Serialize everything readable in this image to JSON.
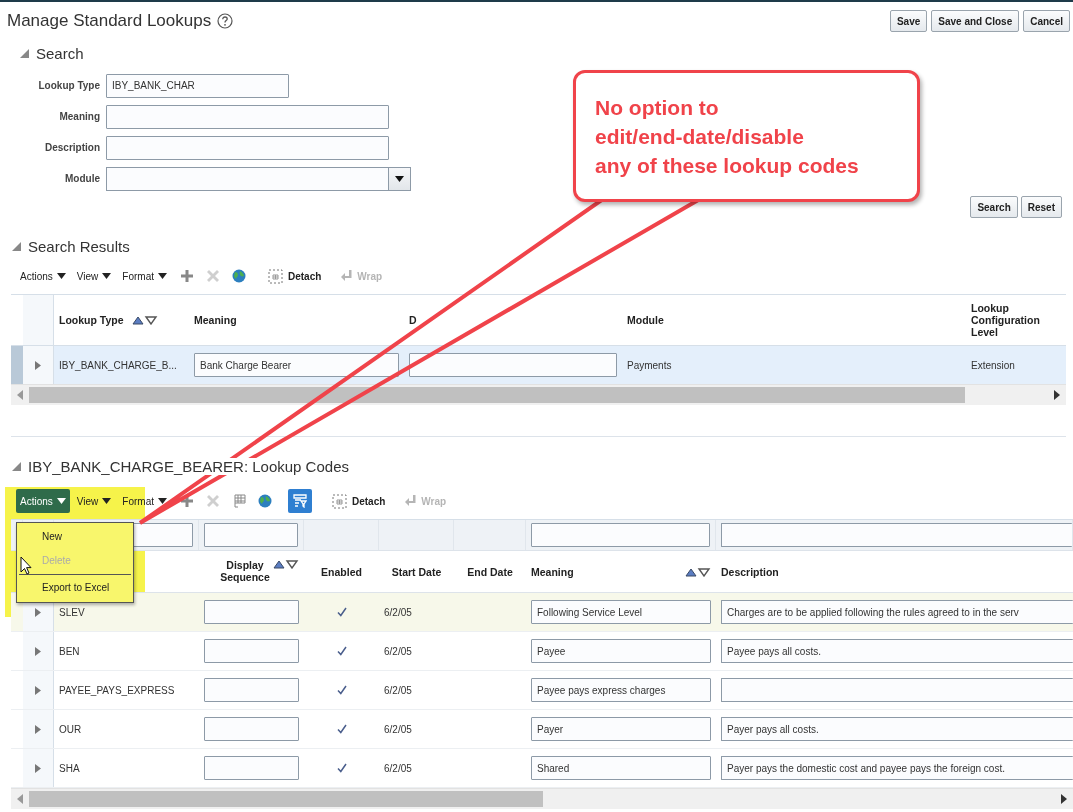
{
  "page": {
    "title": "Manage Standard Lookups",
    "buttons": [
      "Save",
      "Save and Close",
      "Cancel"
    ]
  },
  "search": {
    "title": "Search",
    "expanded": true,
    "fields": [
      {
        "label": "Lookup Type",
        "kind": "short",
        "value": "IBY_BANK_CHAR"
      },
      {
        "label": "Meaning",
        "kind": "text"
      },
      {
        "label": "Description",
        "kind": "text"
      },
      {
        "label": "Module",
        "kind": "select"
      }
    ],
    "buttons": [
      "Search",
      "Reset"
    ]
  },
  "results": {
    "title": "Search Results",
    "expanded": true,
    "toolbar": [
      {
        "kind": "menu",
        "label": "Actions",
        "active": false
      },
      {
        "kind": "menu",
        "label": "View",
        "active": false
      },
      {
        "kind": "menu",
        "label": "Format",
        "active": false
      },
      {
        "kind": "add",
        "disabled": false
      },
      {
        "kind": "delete",
        "disabled": true
      },
      {
        "kind": "globe",
        "disabled": false
      },
      {
        "kind": "detach",
        "label": "Detach",
        "disabled": false
      },
      {
        "kind": "wrap",
        "label": "Wrap",
        "disabled": true
      }
    ],
    "columns": [
      {
        "label": "Lookup Type",
        "sortable": true
      },
      {
        "label": "Meaning",
        "sortable": false
      },
      {
        "label": "D",
        "sortable": false
      },
      {
        "label": "Module",
        "sortable": false
      },
      {
        "label": "Lookup Configuration Level",
        "sortable": false
      }
    ],
    "rows": [
      {
        "selected": true,
        "lookup_type": "IBY_BANK_CHARGE_B...",
        "meaning": "Bank Charge Bearer",
        "module": "Payments",
        "configuration_level": "Extension"
      }
    ]
  },
  "codes": {
    "title": "IBY_BANK_CHARGE_BEARER: Lookup Codes",
    "expanded": true,
    "toolbar": [
      {
        "kind": "menu",
        "label": "Actions",
        "active": true
      },
      {
        "kind": "menu",
        "label": "View",
        "active": false
      },
      {
        "kind": "menu",
        "label": "Format",
        "active": false
      },
      {
        "kind": "add",
        "disabled": false
      },
      {
        "kind": "delete",
        "disabled": true
      },
      {
        "kind": "freeze",
        "disabled": false
      },
      {
        "kind": "globe",
        "disabled": false
      },
      {
        "kind": "query",
        "selected": true
      },
      {
        "kind": "detach",
        "label": "Detach",
        "disabled": false
      },
      {
        "kind": "wrap",
        "label": "Wrap",
        "disabled": true
      }
    ],
    "columns": [
      {
        "label": "Display Sequence",
        "sortable": true
      },
      {
        "label": "Enabled",
        "sortable": false
      },
      {
        "label": "Start Date",
        "sortable": false
      },
      {
        "label": "End Date",
        "sortable": false
      },
      {
        "label": "Meaning",
        "sortable": true
      },
      {
        "label": "Description",
        "sortable": false
      }
    ],
    "rows": [
      {
        "selected": true,
        "code": "SLEV",
        "enabled": true,
        "start_date": "6/2/05",
        "meaning": "Following Service Level",
        "description": "Charges are to be applied following the rules agreed to in the serv"
      },
      {
        "selected": false,
        "code": "BEN",
        "enabled": true,
        "start_date": "6/2/05",
        "meaning": "Payee",
        "description": "Payee pays all costs."
      },
      {
        "selected": false,
        "code": "PAYEE_PAYS_EXPRESS",
        "enabled": true,
        "start_date": "6/2/05",
        "meaning": "Payee pays express charges"
      },
      {
        "selected": false,
        "code": "OUR",
        "enabled": true,
        "start_date": "6/2/05",
        "meaning": "Payer",
        "description": "Payer pays all costs."
      },
      {
        "selected": false,
        "code": "SHA",
        "enabled": true,
        "start_date": "6/2/05",
        "meaning": "Shared",
        "description": "Payer pays the domestic cost and payee pays the foreign cost."
      }
    ],
    "menu": {
      "items": [
        {
          "label": "New",
          "disabled": false,
          "separator_before": false
        },
        {
          "label": "Delete",
          "disabled": true,
          "separator_before": false
        },
        {
          "label": "Export to Excel",
          "disabled": false,
          "separator_before": true
        }
      ]
    }
  },
  "callout": {
    "lines": [
      "No option to",
      "edit/end-date/disable",
      "any of these lookup codes"
    ]
  }
}
